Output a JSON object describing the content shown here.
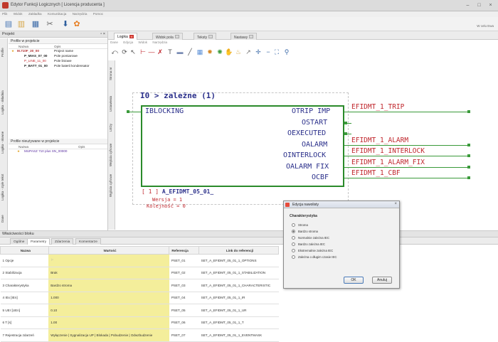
{
  "window": {
    "title": "Edytor Funkcji Logicznych [ Licencja producenta ]",
    "user": "W celu Ewa"
  },
  "menu": [
    "Plik",
    "Widok",
    "Zakładka",
    "Komunikacja",
    "Narzędzia",
    "Pomoc"
  ],
  "toolbar_icons": [
    "new-file-icon",
    "open-folder-icon",
    "save-icon",
    "tools-icon",
    "download-icon",
    "settings-icon"
  ],
  "left_panel": {
    "title": "Projekt",
    "vertical_tabs": [
      "Profile",
      "Logika - składnia",
      "Logika - słowne",
      "Logika - style tekst",
      "Dane"
    ],
    "section1": "Profile w projekcie",
    "col_name": "Nazwa",
    "col_desc": "Opis",
    "items": [
      {
        "name": "M.710F_20_00",
        "desc": "Project name"
      },
      {
        "name": "P_MIAS_07_00",
        "desc": "Pole pomiarowe"
      },
      {
        "name": "P_LINE_11_00",
        "desc": "Pole liniowe"
      },
      {
        "name": "P_BATT_01_00",
        "desc": "Pole baterii kondensator"
      }
    ],
    "section2": "Profile nieużywane w projekcie",
    "col2_name": "Nazwa",
    "col2_desc": "Opis",
    "unused": [
      {
        "name": "MUPASZ 710 plus SN_00000",
        "desc": ""
      }
    ]
  },
  "doc_tabs": [
    "Logika",
    "Widok pola",
    "Teksty",
    "Nastawy"
  ],
  "submenu": [
    "Dane",
    "Edycja",
    "Widok",
    "Narzędzia"
  ],
  "inner_tabs": [
    "Strona nr",
    "Ustawienia",
    "LEDy",
    "Wejścia cyfrowe",
    "Wyjścia cyfrowe"
  ],
  "diagram": {
    "block_title": "I0 > zależne (1)",
    "input": "IBLOCKING",
    "outputs": [
      "OTRIP IMP",
      "OSTART",
      "OEXECUTED",
      "OALARM",
      "OINTERLOCK",
      "OALARM FIX",
      "OCBF"
    ],
    "signals": [
      "EFIDMT_1_TRIP",
      "EFIDMT_1_ALARM",
      "EFIDMT_1_INTERLOCK",
      "EFIDMT_1_ALARM_FIX",
      "EFIDMT_1_CBF"
    ],
    "instance_num": "[ 1 ]",
    "instance_name": "A_EFIDMT_05_01_",
    "version": "Wersja = 1",
    "order": "Kolejność = 0"
  },
  "bottom": {
    "title": "Właściwości bloku",
    "tabs": [
      "Ogólne",
      "Parametry",
      "Zdarzenia",
      "Komentarze"
    ],
    "headers": [
      "Nazwa",
      "Wartość",
      "Referencja",
      "Link do referencji"
    ],
    "rows": [
      {
        "n": "1",
        "name": "Opcje",
        "value": "",
        "ref": "PSET_01",
        "link": "SET_A_EFIDMT_05_01_1_OPTIONS"
      },
      {
        "n": "2",
        "name": "Stabilizacja",
        "value": "Brak",
        "ref": "PSET_02",
        "link": "SET_A_EFIDMT_05_01_1_STABILIZATION"
      },
      {
        "n": "3",
        "name": "Charakterystyka",
        "value": "Bardzo stroma",
        "ref": "PSET_03",
        "link": "SET_A_EFIDMT_05_01_1_CHARACTERISTIC"
      },
      {
        "n": "4",
        "name": "IEx [IEn]",
        "value": "1.000",
        "ref": "PSET_04",
        "link": "SET_A_EFIDMT_05_01_1_IR"
      },
      {
        "n": "5",
        "name": "UEr [UEn]",
        "value": "0.10",
        "ref": "PSET_05",
        "link": "SET_A_EFIDMT_05_01_1_UR"
      },
      {
        "n": "6",
        "name": "T [s]",
        "value": "1.00",
        "ref": "PSET_06",
        "link": "SET_A_EFIDMT_05_01_1_T"
      },
      {
        "n": "7",
        "name": "Rejestracja zdarzeń",
        "value": "Wyłączenie | Sygnalizacja UP | Blokada | Pobudzenie | Odwzbudzenie",
        "ref": "PSET_07",
        "link": "SET_A_EFIDMT_05_01_1_EVENTMASK"
      }
    ]
  },
  "dialog": {
    "title": "Edycja nawolisty",
    "group": "Charakterystyka",
    "options": [
      "Stroma",
      "Bardzo stroma",
      "Normalnie zależna IEC",
      "Bardzo zależna IEC",
      "Ekstremalnie zależna IEC",
      "Zależna o długim czasie IEC"
    ],
    "selected": 1,
    "ok": "OK",
    "cancel": "Anuluj"
  }
}
